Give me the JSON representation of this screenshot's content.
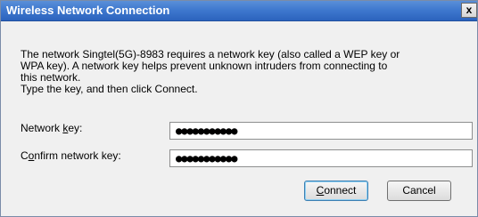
{
  "dialog": {
    "title": "Wireless Network Connection",
    "close_glyph": "x",
    "message_line1": "The network  Singtel(5G)-8983  requires a network key (also called a WEP key or",
    "message_line2": "WPA key). A network key helps prevent unknown intruders from connecting to",
    "message_line3": "this network.",
    "message_line4": "Type the key, and then click Connect."
  },
  "form": {
    "network_key_label_pre": "Network ",
    "network_key_label_accel": "k",
    "network_key_label_post": "ey:",
    "network_key_value": "●●●●●●●●●●●",
    "confirm_key_label_pre": "C",
    "confirm_key_label_accel": "o",
    "confirm_key_label_post": "nfirm network key:",
    "confirm_key_value": "●●●●●●●●●●●"
  },
  "buttons": {
    "connect_accel": "C",
    "connect_rest": "onnect",
    "cancel_label": "Cancel"
  },
  "colors": {
    "titlebar": "#3f79cf",
    "dialog_bg": "#f0f0f0"
  }
}
